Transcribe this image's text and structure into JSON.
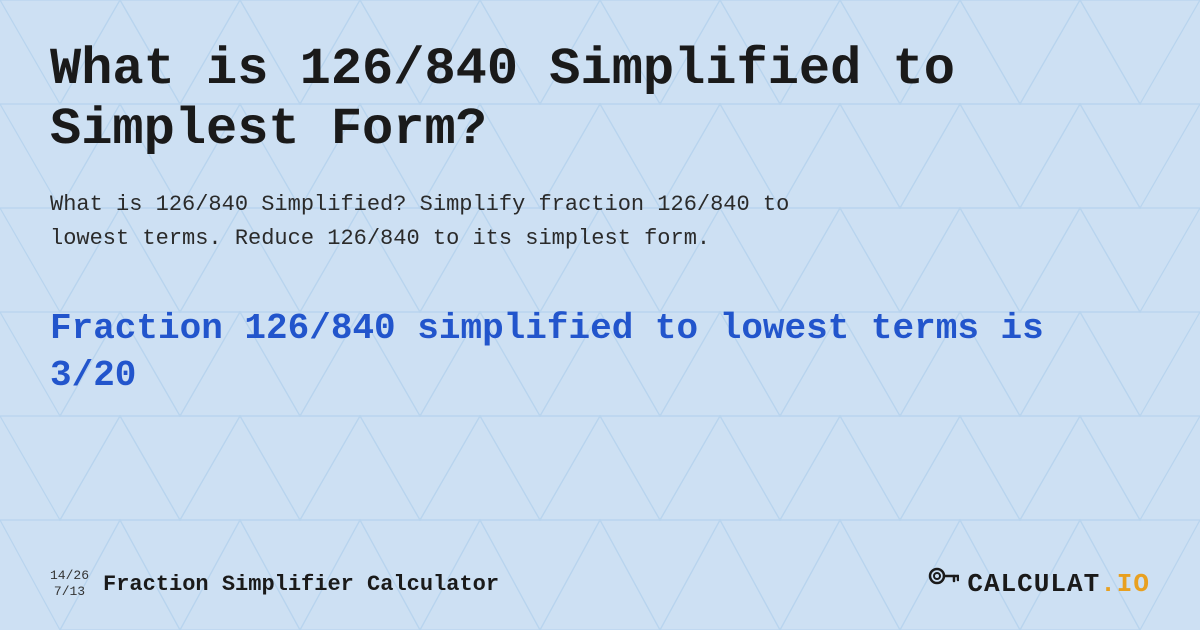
{
  "page": {
    "background_color": "#d6e8f7",
    "title": "What is 126/840 Simplified to Simplest Form?",
    "description_line1": "What is 126/840 Simplified? Simplify fraction 126/840 to",
    "description_line2": "lowest terms. Reduce 126/840 to its simplest form.",
    "result_line1": "Fraction 126/840 simplified to lowest terms is",
    "result_line2": "3/20",
    "footer": {
      "fraction_top": "14/26",
      "fraction_bottom": "7/13",
      "site_title": "Fraction Simplifier Calculator",
      "logo_text_main": "CALCULAT",
      "logo_text_suffix": ".IO"
    }
  }
}
